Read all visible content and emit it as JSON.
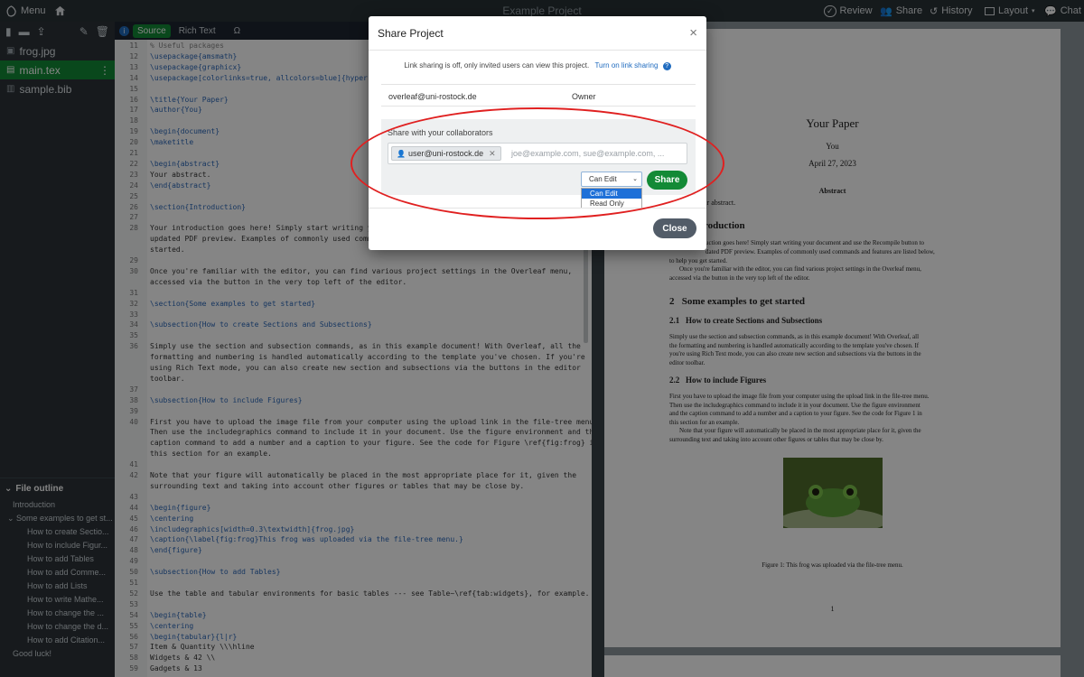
{
  "topbar": {
    "menu_label": "Menu",
    "project_title": "Example Project",
    "review_label": "Review",
    "share_label": "Share",
    "history_label": "History",
    "layout_label": "Layout",
    "chat_label": "Chat"
  },
  "sidebar": {
    "files": [
      {
        "name": "frog.jpg",
        "icon": "image-icon"
      },
      {
        "name": "main.tex",
        "icon": "file-icon"
      },
      {
        "name": "sample.bib",
        "icon": "book-icon"
      }
    ],
    "outline_title": "File outline",
    "outline_items": [
      "Introduction",
      "Some examples to get st...",
      "How to create Sectio...",
      "How to include Figur...",
      "How to add Tables",
      "How to add Comme...",
      "How to add Lists",
      "How to write Mathe...",
      "How to change the ...",
      "How to change the d...",
      "How to add Citation...",
      "Good luck!"
    ]
  },
  "editor": {
    "tab_source": "Source",
    "tab_rich": "Rich Text",
    "omega": "Ω",
    "lines": [
      {
        "n": "11",
        "t": "% Useful packages",
        "c": "cmt"
      },
      {
        "n": "12",
        "t": "\\usepackage{amsmath}",
        "c": "cmd"
      },
      {
        "n": "13",
        "t": "\\usepackage{graphicx}",
        "c": "cmd"
      },
      {
        "n": "14",
        "t": "\\usepackage[colorlinks=true, allcolors=blue]{hyperref}",
        "c": "cmd"
      },
      {
        "n": "15",
        "t": "",
        "c": ""
      },
      {
        "n": "16",
        "t": "\\title{Your Paper}",
        "c": "cmd"
      },
      {
        "n": "17",
        "t": "\\author{You}",
        "c": "cmd"
      },
      {
        "n": "18",
        "t": "",
        "c": ""
      },
      {
        "n": "19",
        "t": "\\begin{document}",
        "c": "cmd"
      },
      {
        "n": "20",
        "t": "\\maketitle",
        "c": "cmd"
      },
      {
        "n": "21",
        "t": "",
        "c": ""
      },
      {
        "n": "22",
        "t": "\\begin{abstract}",
        "c": "cmd"
      },
      {
        "n": "23",
        "t": "Your abstract.",
        "c": ""
      },
      {
        "n": "24",
        "t": "\\end{abstract}",
        "c": "cmd"
      },
      {
        "n": "25",
        "t": "",
        "c": ""
      },
      {
        "n": "26",
        "t": "\\section{Introduction}",
        "c": "cmd"
      },
      {
        "n": "27",
        "t": "",
        "c": ""
      },
      {
        "n": "28",
        "t": "Your introduction goes here! Simply start writing your",
        "c": ""
      },
      {
        "n": "",
        "t": "updated PDF preview. Examples of commonly used comma",
        "c": ""
      },
      {
        "n": "",
        "t": "started.",
        "c": ""
      },
      {
        "n": "29",
        "t": "",
        "c": ""
      },
      {
        "n": "30",
        "t": "Once you're familiar with the editor, you can find various project settings in the Overleaf menu,",
        "c": ""
      },
      {
        "n": "",
        "t": "accessed via the button in the very top left of the editor.",
        "c": ""
      },
      {
        "n": "31",
        "t": "",
        "c": ""
      },
      {
        "n": "32",
        "t": "\\section{Some examples to get started}",
        "c": "cmd"
      },
      {
        "n": "33",
        "t": "",
        "c": ""
      },
      {
        "n": "34",
        "t": "\\subsection{How to create Sections and Subsections}",
        "c": "cmd"
      },
      {
        "n": "35",
        "t": "",
        "c": ""
      },
      {
        "n": "36",
        "t": "Simply use the section and subsection commands, as in this example document! With Overleaf, all the",
        "c": ""
      },
      {
        "n": "",
        "t": "formatting and numbering is handled automatically according to the template you've chosen. If you're",
        "c": ""
      },
      {
        "n": "",
        "t": "using Rich Text mode, you can also create new section and subsections via the buttons in the editor",
        "c": ""
      },
      {
        "n": "",
        "t": "toolbar.",
        "c": ""
      },
      {
        "n": "37",
        "t": "",
        "c": ""
      },
      {
        "n": "38",
        "t": "\\subsection{How to include Figures}",
        "c": "cmd"
      },
      {
        "n": "39",
        "t": "",
        "c": ""
      },
      {
        "n": "40",
        "t": "First you have to upload the image file from your computer using the upload link in the file-tree menu.",
        "c": ""
      },
      {
        "n": "",
        "t": "Then use the includegraphics command to include it in your document. Use the figure environment and the",
        "c": ""
      },
      {
        "n": "",
        "t": "caption command to add a number and a caption to your figure. See the code for Figure \\ref{fig:frog} in",
        "c": ""
      },
      {
        "n": "",
        "t": "this section for an example.",
        "c": ""
      },
      {
        "n": "41",
        "t": "",
        "c": ""
      },
      {
        "n": "42",
        "t": "Note that your figure will automatically be placed in the most appropriate place for it, given the",
        "c": ""
      },
      {
        "n": "",
        "t": "surrounding text and taking into account other figures or tables that may be close by.",
        "c": ""
      },
      {
        "n": "43",
        "t": "",
        "c": ""
      },
      {
        "n": "44",
        "t": "\\begin{figure}",
        "c": "cmd"
      },
      {
        "n": "45",
        "t": "\\centering",
        "c": "cmd"
      },
      {
        "n": "46",
        "t": "\\includegraphics[width=0.3\\textwidth]{frog.jpg}",
        "c": "cmd"
      },
      {
        "n": "47",
        "t": "\\caption{\\label{fig:frog}This frog was uploaded via the file-tree menu.}",
        "c": "cmd"
      },
      {
        "n": "48",
        "t": "\\end{figure}",
        "c": "cmd"
      },
      {
        "n": "49",
        "t": "",
        "c": ""
      },
      {
        "n": "50",
        "t": "\\subsection{How to add Tables}",
        "c": "cmd"
      },
      {
        "n": "51",
        "t": "",
        "c": ""
      },
      {
        "n": "52",
        "t": "Use the table and tabular environments for basic tables --- see Table~\\ref{tab:widgets}, for example.",
        "c": ""
      },
      {
        "n": "53",
        "t": "",
        "c": ""
      },
      {
        "n": "54",
        "t": "\\begin{table}",
        "c": "cmd"
      },
      {
        "n": "55",
        "t": "\\centering",
        "c": "cmd"
      },
      {
        "n": "56",
        "t": "\\begin{tabular}{l|r}",
        "c": "cmd"
      },
      {
        "n": "57",
        "t": "Item & Quantity \\\\\\hline",
        "c": ""
      },
      {
        "n": "58",
        "t": "Widgets & 42 \\\\",
        "c": ""
      },
      {
        "n": "59",
        "t": "Gadgets & 13",
        "c": ""
      }
    ]
  },
  "pdf": {
    "title": "Your Paper",
    "author": "You",
    "date": "April 27, 2023",
    "abstract_title": "Abstract",
    "abstract_text": "ar abstract.",
    "section1": "roduction",
    "intro_p1": "uction goes here! Simply start writing your document and use the Recompile button to",
    "intro_p2": "dated PDF preview. Examples of commonly used commands and features are listed below,",
    "intro_p3": "to help you get started.",
    "intro_p4": "Once you're familiar with the editor, you can find various project settings in the Overleaf menu,",
    "intro_p5": "accessed via the button in the very top left of the editor.",
    "section2": "2   Some examples to get started",
    "sub21": "2.1   How to create Sections and Subsections",
    "sub21_p": [
      "Simply use the section and subsection commands, as in this example document! With Overleaf, all",
      "the formatting and numbering is handled automatically according to the template you've chosen. If",
      "you're using Rich Text mode, you can also create new section and subsections via the buttons in the",
      "editor toolbar."
    ],
    "sub22": "2.2   How to include Figures",
    "sub22_p": [
      "First you have to upload the image file from your computer using the upload link in the file-tree menu.",
      "Then use the includegraphics command to include it in your document. Use the figure environment",
      "and the caption command to add a number and a caption to your figure. See the code for Figure 1 in",
      "this section for an example.",
      "Note that your figure will automatically be placed in the most appropriate place for it, given the",
      "surrounding text and taking into account other figures or tables that may be close by."
    ],
    "figure_caption": "Figure 1: This frog was uploaded via the file-tree menu.",
    "page_number": "1"
  },
  "modal": {
    "title": "Share Project",
    "close_x": "×",
    "link_info": "Link sharing is off, only invited users can view this project.",
    "link_action": "Turn on link sharing",
    "owner_email": "overleaf@uni-rostock.de",
    "owner_role": "Owner",
    "collab_label": "Share with your collaborators",
    "chip_email": "user@uni-rostock.de",
    "input_placeholder": "joe@example.com, sue@example.com, ...",
    "permission_selected": "Can Edit",
    "permission_options": [
      "Can Edit",
      "Read Only"
    ],
    "share_button": "Share",
    "close_button": "Close"
  },
  "colors": {
    "accent_green": "#138a36",
    "link_blue": "#1f6bbf",
    "annotation_red": "#e02020"
  }
}
